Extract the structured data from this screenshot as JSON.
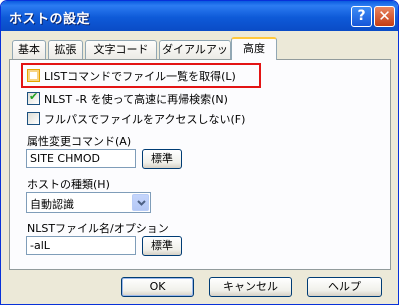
{
  "window": {
    "title": "ホストの設定",
    "help_glyph": "?",
    "close_glyph": "✕"
  },
  "tabs": [
    {
      "label": "基本"
    },
    {
      "label": "拡張"
    },
    {
      "label": "文字コード"
    },
    {
      "label": "ダイアルアップ"
    },
    {
      "label": "高度",
      "active": true
    }
  ],
  "options": {
    "list_command": {
      "label": "LISTコマンドでファイル一覧を取得(L)",
      "checked": false
    },
    "nlst_r": {
      "label": "NLST -R を使って高速に再帰検索(N)",
      "checked": true
    },
    "no_full_path": {
      "label": "フルパスでファイルをアクセスしない(F)",
      "checked": false
    }
  },
  "attr_command": {
    "label": "属性変更コマンド(A)",
    "value": "SITE CHMOD",
    "default_button": "標準"
  },
  "host_type": {
    "label": "ホストの種類(H)",
    "selected": "自動認識"
  },
  "nlst_name": {
    "label": "NLSTファイル名/オプション",
    "value": "-alL",
    "default_button": "標準"
  },
  "footer": {
    "ok": "OK",
    "cancel": "キャンセル",
    "help": "ヘルプ"
  },
  "colors": {
    "title_bar": "#0a5bdf",
    "highlight_box": "#e31414",
    "checkmark": "#21a121"
  }
}
